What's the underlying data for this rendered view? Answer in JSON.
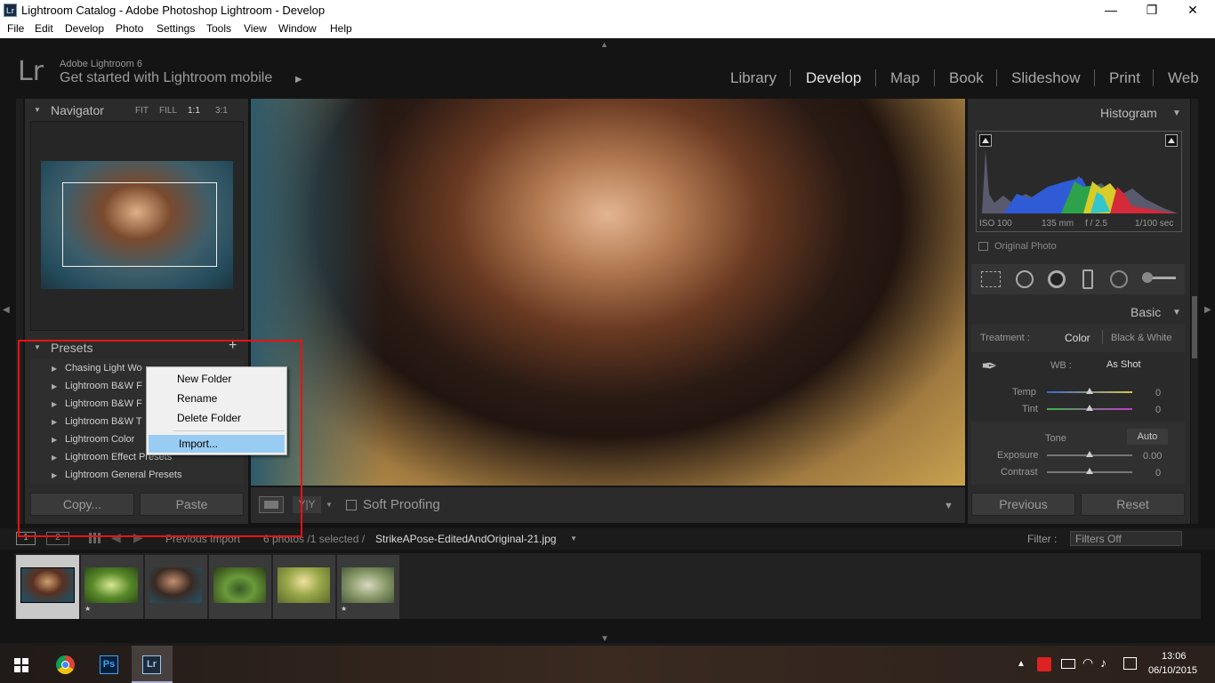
{
  "window": {
    "title": "Lightroom Catalog - Adobe Photoshop Lightroom - Develop",
    "app_icon": "Lr",
    "minimize": "—",
    "restore": "❐",
    "close": "✕"
  },
  "menu": [
    "File",
    "Edit",
    "Develop",
    "Photo",
    "Settings",
    "Tools",
    "View",
    "Window",
    "Help"
  ],
  "identity": {
    "logo": "Lr",
    "brand": "Adobe Lightroom 6",
    "mobile": "Get started with Lightroom mobile",
    "mobile_arrow": "▶"
  },
  "modules": [
    "Library",
    "Develop",
    "Map",
    "Book",
    "Slideshow",
    "Print",
    "Web"
  ],
  "active_module": "Develop",
  "navigator": {
    "title": "Navigator",
    "fit": "FIT",
    "fill": "FILL",
    "one_to_one": "1:1",
    "three_to_one": "3:1"
  },
  "presets": {
    "title": "Presets",
    "add": "+",
    "items": [
      "Chasing Light Wo",
      "Lightroom B&W F",
      "Lightroom B&W F",
      "Lightroom B&W T",
      "Lightroom Color",
      "Lightroom Effect Presets",
      "Lightroom General Presets"
    ]
  },
  "left_buttons": {
    "copy": "Copy...",
    "paste": "Paste"
  },
  "context_menu": {
    "items": [
      "New Folder",
      "Rename",
      "Delete Folder",
      "Import..."
    ],
    "highlighted": "Import..."
  },
  "toolbar": {
    "soft_proofing": "Soft Proofing",
    "compare": "Y|Y"
  },
  "histogram": {
    "title": "Histogram",
    "iso": "ISO 100",
    "focal": "135 mm",
    "aperture": "f / 2.5",
    "shutter": "1/100 sec",
    "original_photo": "Original Photo"
  },
  "basic": {
    "title": "Basic",
    "treatment_label": "Treatment :",
    "color": "Color",
    "bw": "Black & White",
    "wb_label": "WB :",
    "wb_value": "As Shot",
    "temp_label": "Temp",
    "temp_value": "0",
    "tint_label": "Tint",
    "tint_value": "0",
    "tone": "Tone",
    "auto": "Auto",
    "exposure_label": "Exposure",
    "exposure_value": "0.00",
    "contrast_label": "Contrast",
    "contrast_value": "0"
  },
  "right_buttons": {
    "previous": "Previous",
    "reset": "Reset"
  },
  "filmstrip": {
    "page1": "1",
    "page2": "2",
    "source": "Previous Import",
    "count": "6 photos /1 selected /",
    "filename": "StrikeAPose-EditedAndOriginal-21.jpg",
    "filter_label": "Filter :",
    "filter_value": "Filters Off",
    "star": "★"
  },
  "taskbar": {
    "time": "13:06",
    "date": "06/10/2015",
    "lr_label": "Lr",
    "ps_label": "Ps"
  },
  "colors": {
    "accent_red": "#e11111",
    "menu_highlight": "#99ccf2"
  }
}
